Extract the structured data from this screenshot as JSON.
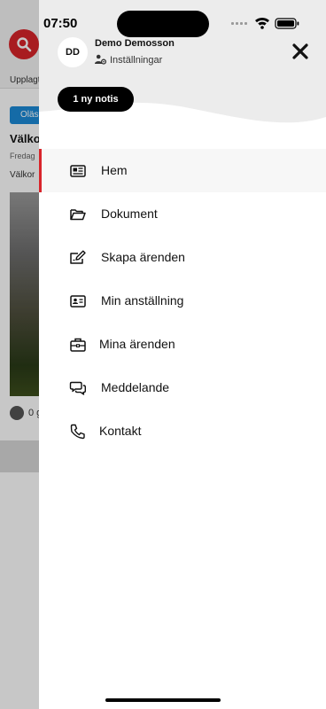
{
  "status_bar": {
    "time": "07:50"
  },
  "background": {
    "upplagt": "Upplagt",
    "olast_badge": "Oläs",
    "post_title": "Välko",
    "post_date": "Fredag",
    "post_text": "Välkor",
    "like_count": "0 g"
  },
  "drawer": {
    "avatar_initials": "DD",
    "user_name": "Demo Demosson",
    "settings_label": "Inställningar",
    "notification_pill": "1 ny notis",
    "menu": [
      {
        "label": "Hem",
        "icon": "newspaper-icon",
        "active": true
      },
      {
        "label": "Dokument",
        "icon": "folder-icon",
        "active": false
      },
      {
        "label": "Skapa ärenden",
        "icon": "edit-icon",
        "active": false
      },
      {
        "label": "Min anställning",
        "icon": "id-card-icon",
        "active": false
      },
      {
        "label": "Mina ärenden",
        "icon": "briefcase-icon",
        "active": false
      },
      {
        "label": "Meddelande",
        "icon": "chat-icon",
        "active": false
      },
      {
        "label": "Kontakt",
        "icon": "phone-icon",
        "active": false
      }
    ]
  },
  "colors": {
    "accent": "#d8242a",
    "badge_blue": "#1c8ad6",
    "pill_black": "#000000"
  }
}
